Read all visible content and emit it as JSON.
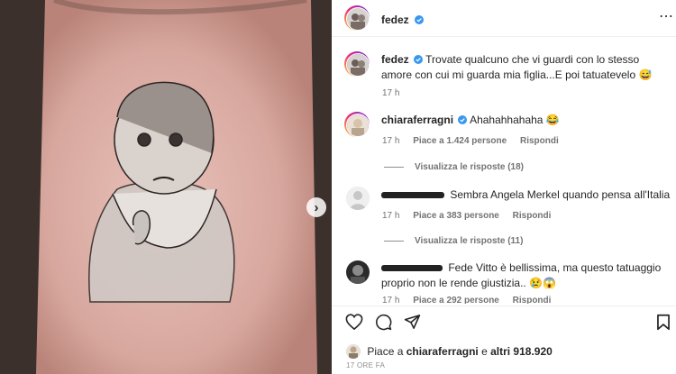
{
  "post": {
    "author": "fedez",
    "caption": {
      "username": "fedez",
      "text": "Trovate qualcuno che vi guardi con lo stesso amore con cui mi guarda mia figlia...E poi tatuatevelo",
      "emoji": "😅",
      "time": "17 h"
    }
  },
  "comments": [
    {
      "username": "chiaraferragni",
      "verified": true,
      "text": "Ahahahhahaha",
      "emoji": "😂",
      "time": "17 h",
      "likes": "Piace a 1.424 persone",
      "reply": "Rispondi",
      "view_replies": "Visualizza le risposte (18)"
    },
    {
      "username_hidden": true,
      "text": "Sembra Angela Merkel quando pensa all'Italia",
      "time": "17 h",
      "likes": "Piace a 383 persone",
      "reply": "Rispondi",
      "view_replies": "Visualizza le risposte (11)"
    },
    {
      "username_hidden": true,
      "text": "Fede Vitto è bellissima, ma questo tatuaggio proprio non le rende giustizia..",
      "emoji": "😢😱",
      "time": "17 h",
      "likes": "Piace a 292 persone",
      "reply": "Rispondi"
    }
  ],
  "liked_by": {
    "prefix": "Piace a ",
    "user": "chiaraferragni",
    "middle": " e ",
    "others": "altri 918.920"
  },
  "timestamp": "17 ORE FA",
  "icons": [
    "next-arrow-icon",
    "verified-badge-icon",
    "more-options-icon",
    "heart-icon",
    "comment-icon",
    "share-icon",
    "save-icon"
  ],
  "colors": {
    "verified": "#3897f0",
    "text": "#262626",
    "muted": "#737373"
  }
}
